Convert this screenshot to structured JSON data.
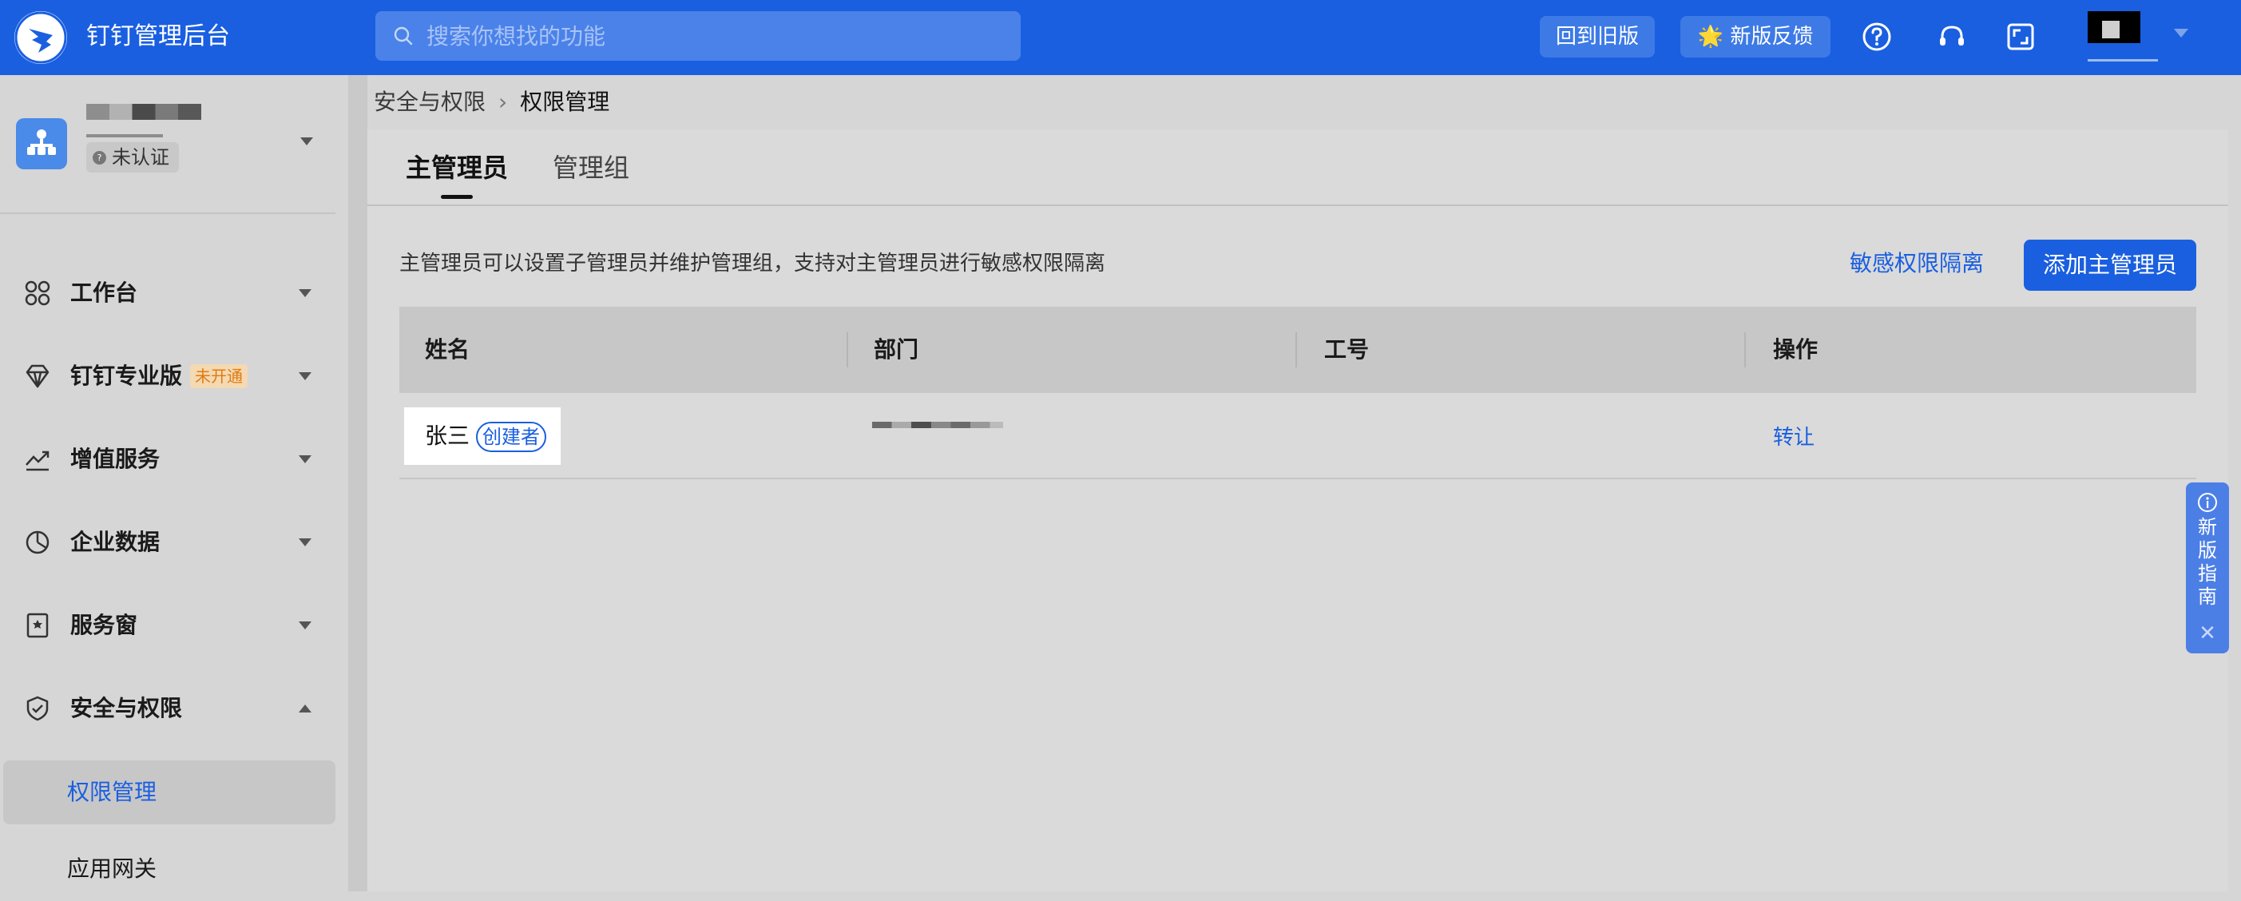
{
  "topbar": {
    "app_title": "钉钉管理后台",
    "search_placeholder": "搜索你想找的功能",
    "back_old_label": "回到旧版",
    "feedback_label": "新版反馈",
    "feedback_emoji": "🌟",
    "icons": [
      "help-icon",
      "headset-icon",
      "fullscreen-icon"
    ]
  },
  "sidebar": {
    "cert_label": "未认证",
    "nav": [
      {
        "label": "工作台",
        "icon": "grid-icon"
      },
      {
        "label": "钉钉专业版",
        "icon": "diamond-icon",
        "tag": "未开通"
      },
      {
        "label": "增值服务",
        "icon": "trend-icon"
      },
      {
        "label": "企业数据",
        "icon": "pie-icon"
      },
      {
        "label": "服务窗",
        "icon": "service-window-icon"
      },
      {
        "label": "安全与权限",
        "icon": "shield-icon"
      }
    ],
    "sub_items": [
      {
        "label": "权限管理",
        "active": true
      },
      {
        "label": "应用网关",
        "active": false
      }
    ]
  },
  "breadcrumb": {
    "parent": "安全与权限",
    "current": "权限管理"
  },
  "tabs": [
    {
      "label": "主管理员",
      "active": true
    },
    {
      "label": "管理组",
      "active": false
    }
  ],
  "main": {
    "description": "主管理员可以设置子管理员并维护管理组，支持对主管理员进行敏感权限隔离",
    "sensitive_link": "敏感权限隔离",
    "add_button": "添加主管理员"
  },
  "table": {
    "headers": [
      "姓名",
      "部门",
      "工号",
      "操作"
    ],
    "rows": [
      {
        "name": "张三",
        "badge": "创建者",
        "employee_id": "",
        "action": "转让"
      }
    ]
  },
  "guide": {
    "label": "新版指南",
    "close": "✕"
  },
  "colors": {
    "brand": "#1a5fe0",
    "tag_bg": "#f4d9b2",
    "tag_text": "#e07a10"
  }
}
